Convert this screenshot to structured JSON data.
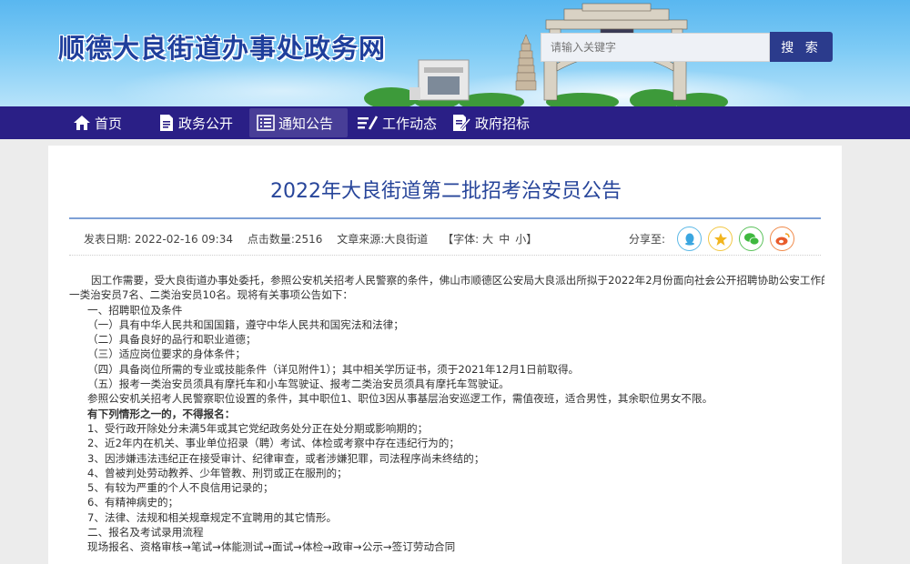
{
  "header": {
    "site_title": "顺德大良街道办事处政务网",
    "search_placeholder": "请输入关键字",
    "search_button": "搜 索",
    "colors": {
      "nav_bg": "#2a1f86",
      "title": "#1f3f9c",
      "search_btn": "#2b3b8c"
    }
  },
  "nav": {
    "items": [
      {
        "label": "首页",
        "icon": "home-icon"
      },
      {
        "label": "政务公开",
        "icon": "document-icon"
      },
      {
        "label": "通知公告",
        "icon": "list-icon"
      },
      {
        "label": "工作动态",
        "icon": "edit-icon"
      },
      {
        "label": "政府招标",
        "icon": "pen-doc-icon"
      }
    ],
    "active": "通知公告"
  },
  "article": {
    "title": "2022年大良街道第二批招考治安员公告",
    "meta": {
      "date": "发表日期: 2022-02-16 09:34",
      "hits": "点击数量:2516",
      "source": "文章来源:大良街道",
      "font_label": "【字体:",
      "font_large": "大",
      "font_medium": "中",
      "font_small": "小",
      "font_close": "】"
    },
    "share_label": "分享至:",
    "share_icons": [
      "qq-icon",
      "qzone-icon",
      "wechat-icon",
      "weibo-icon"
    ],
    "paragraphs": [
      "因工作需要，受大良街道办事处委托，参照公安机关招考人民警察的条件，佛山市顺德区公安局大良派出所拟于2022年2月份面向社会公开招聘协助公安工作的",
      "一类治安员7名、二类治安员10名。现将有关事项公告如下：",
      "一、招聘职位及条件",
      "（一）具有中华人民共和国国籍，遵守中华人民共和国宪法和法律；",
      "（二）具备良好的品行和职业道德；",
      "（三）适应岗位要求的身体条件；",
      "（四）具备岗位所需的专业或技能条件（详见附件1）；其中相关学历证书，须于2021年12月1日前取得。",
      "（五）报考一类治安员须具有摩托车和小车驾驶证、报考二类治安员须具有摩托车驾驶证。",
      "参照公安机关招考人民警察职位设置的条件，其中职位1、职位3因从事基层治安巡逻工作，需值夜班，适合男性，其余职位男女不限。",
      "有下列情形之一的，不得报名：",
      "1、受行政开除处分未满5年或其它党纪政务处分正在处分期或影响期的；",
      "2、近2年内在机关、事业单位招录（聘）考试、体检或考察中存在违纪行为的；",
      "3、因涉嫌违法违纪正在接受审计、纪律审查，或者涉嫌犯罪，司法程序尚未终结的；",
      "4、曾被判处劳动教养、少年管教、刑罚或正在服刑的；",
      "5、有较为严重的个人不良信用记录的；",
      "6、有精神病史的；",
      "7、法律、法规和相关规章规定不宜聘用的其它情形。",
      "二、报名及考试录用流程",
      "现场报名、资格审核→笔试→体能测试→面试→体检→政审→公示→签订劳动合同"
    ]
  }
}
